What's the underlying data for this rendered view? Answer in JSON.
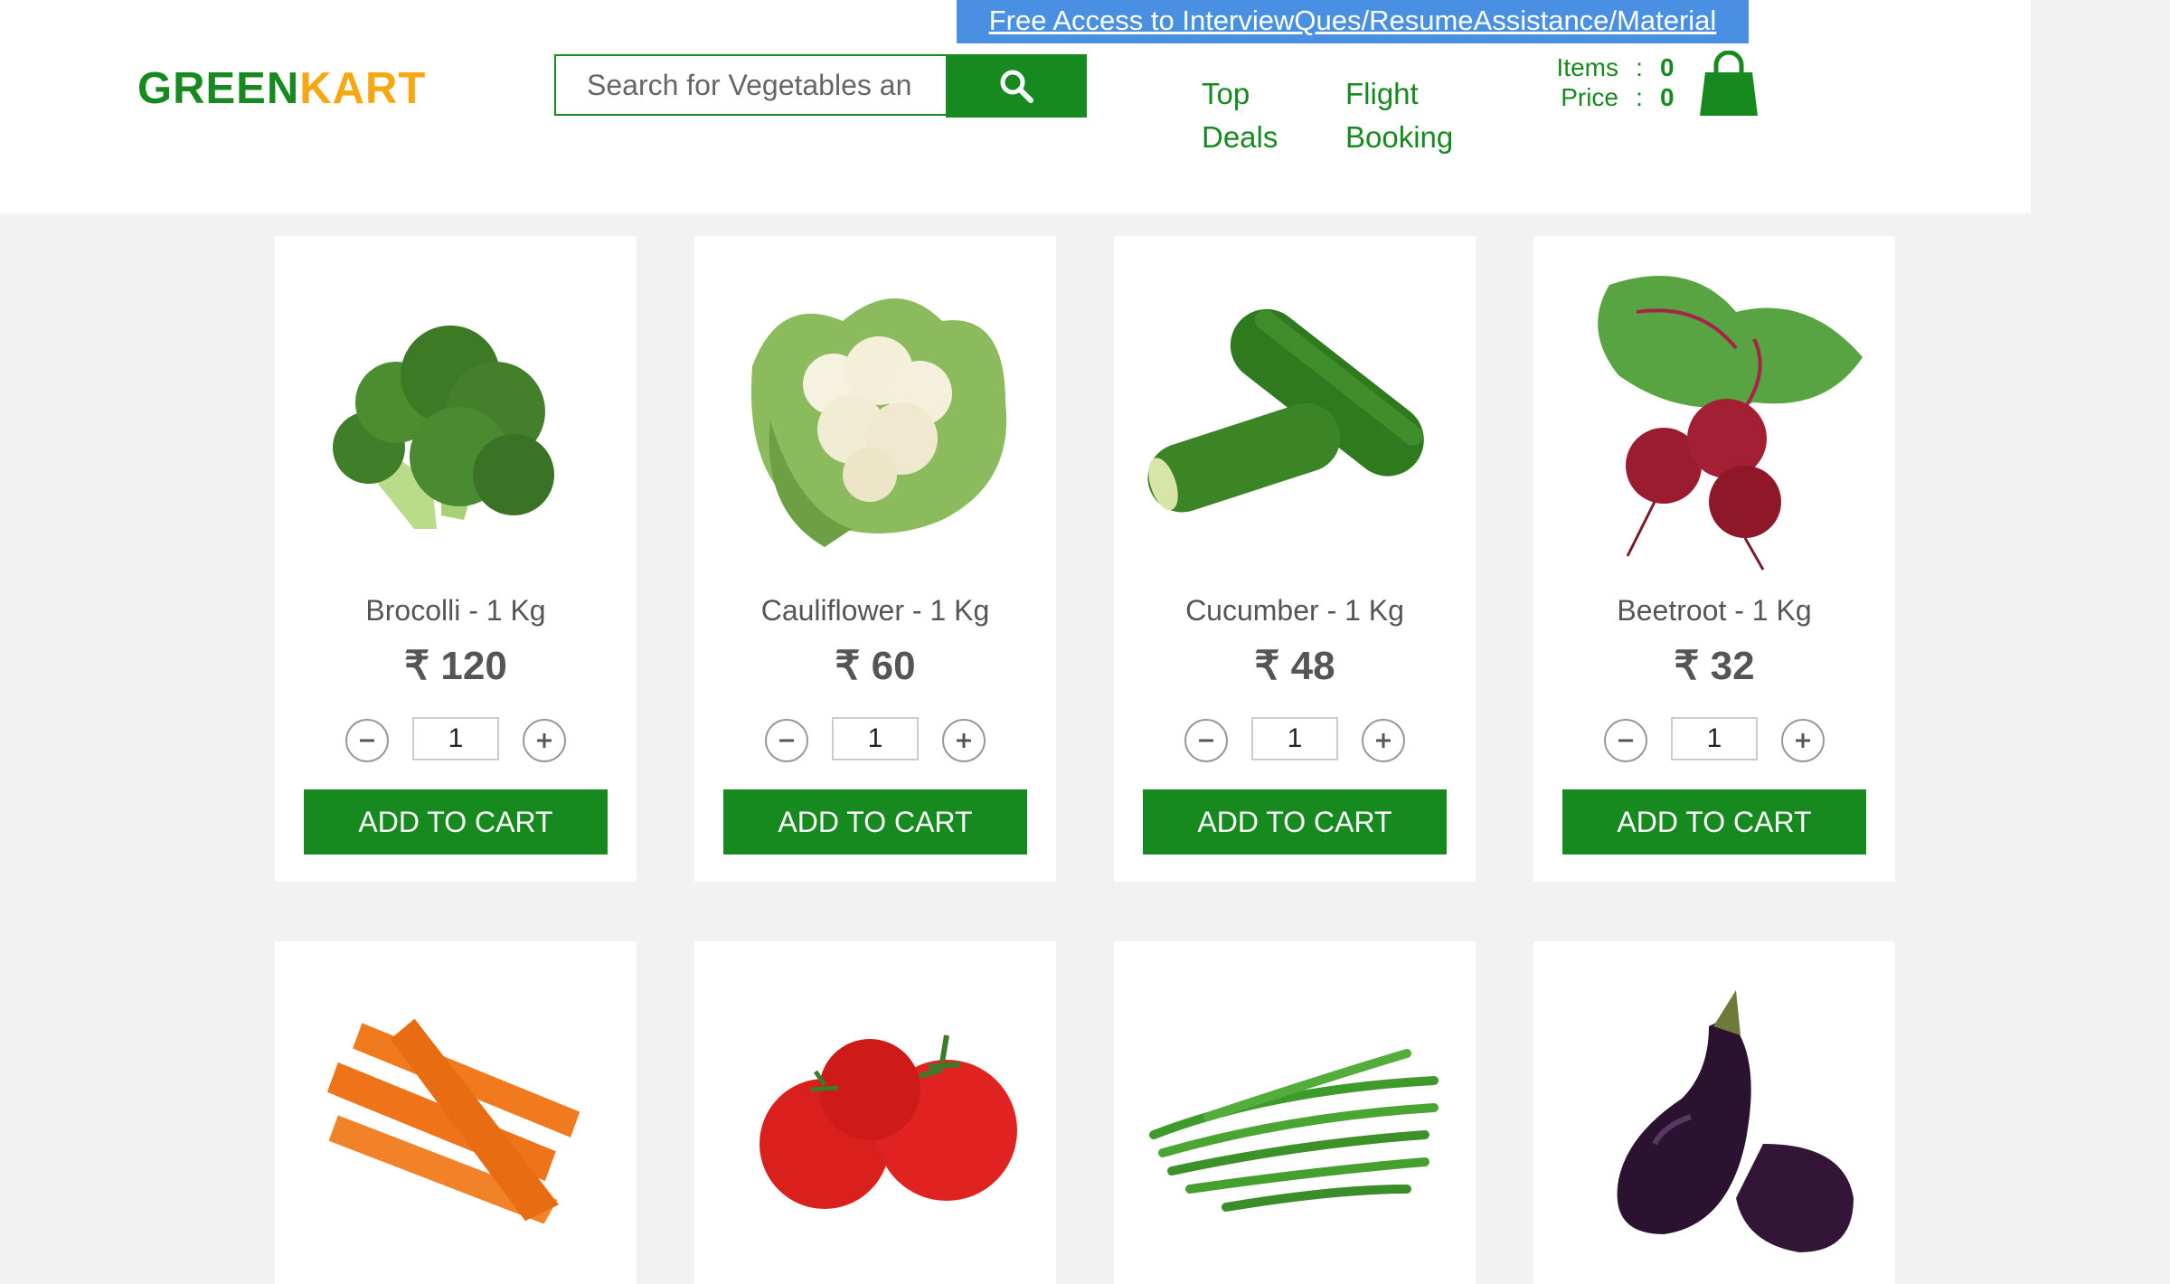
{
  "promo_link": "Free Access to InterviewQues/ResumeAssistance/Material",
  "logo": {
    "part1": "GREEN",
    "part2": "KART"
  },
  "search": {
    "placeholder": "Search for Vegetables an"
  },
  "nav": {
    "top_deals": [
      "Top",
      "Deals"
    ],
    "flight_booking": [
      "Flight",
      "Booking"
    ]
  },
  "cart": {
    "items_label": "Items",
    "items_value": "0",
    "price_label": "Price",
    "price_value": "0",
    "separator": ":"
  },
  "currency_symbol": "₹",
  "products": [
    {
      "name": "Brocolli - 1 Kg",
      "price": "₹ 120",
      "qty": "1",
      "add_label": "ADD TO CART"
    },
    {
      "name": "Cauliflower - 1 Kg",
      "price": "₹ 60",
      "qty": "1",
      "add_label": "ADD TO CART"
    },
    {
      "name": "Cucumber - 1 Kg",
      "price": "₹ 48",
      "qty": "1",
      "add_label": "ADD TO CART"
    },
    {
      "name": "Beetroot - 1 Kg",
      "price": "₹ 32",
      "qty": "1",
      "add_label": "ADD TO CART"
    },
    {
      "image": "carrot"
    },
    {
      "image": "tomato"
    },
    {
      "image": "beans"
    },
    {
      "image": "brinjal"
    }
  ],
  "colors": {
    "brand_green": "#178a1f",
    "brand_orange": "#f7a712",
    "promo_blue": "#4a90e2"
  }
}
